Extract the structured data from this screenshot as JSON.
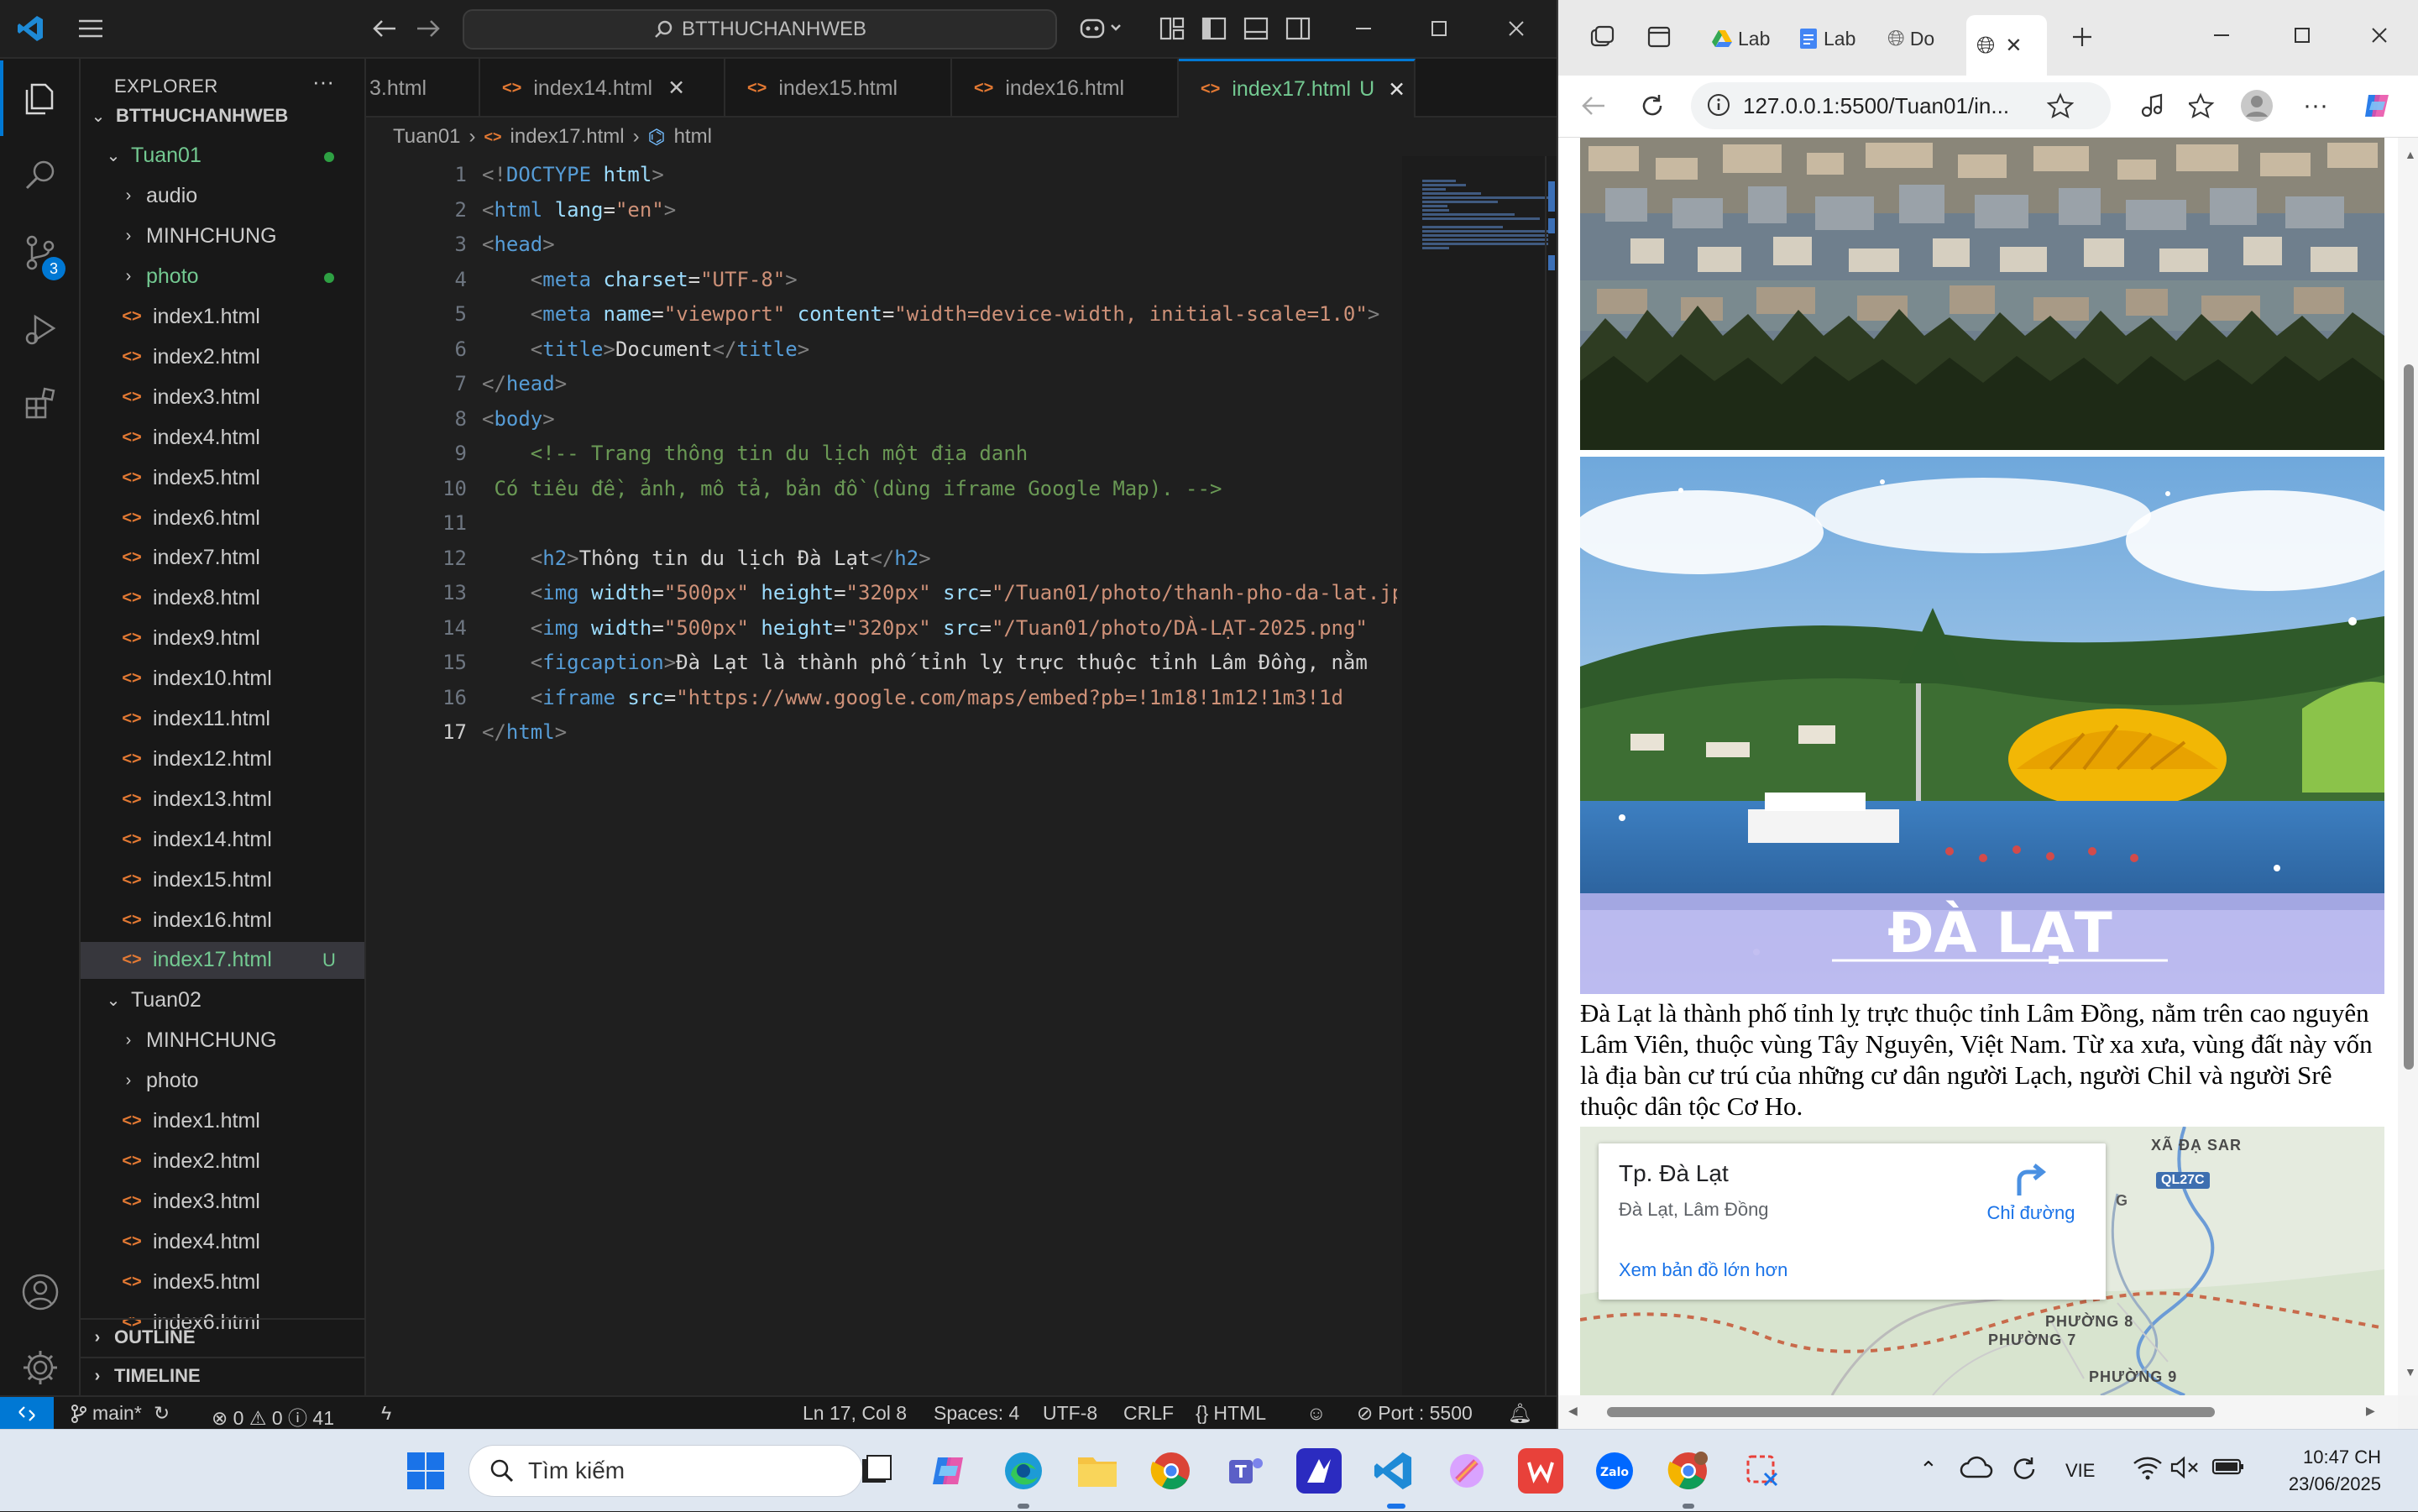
{
  "vscode": {
    "search_text": "BTTHUCHANHWEB",
    "activity_badge": "3",
    "explorer_title": "EXPLORER",
    "explorer_more": "···",
    "tree": [
      {
        "label": "BTTHUCHANHWEB",
        "kind": "root"
      },
      {
        "label": "Tuan01",
        "kind": "folder-open",
        "dot": true
      },
      {
        "label": "audio",
        "kind": "folder"
      },
      {
        "label": "MINHCHUNG",
        "kind": "folder"
      },
      {
        "label": "photo",
        "kind": "folder",
        "dot": true
      },
      {
        "label": "index1.html",
        "kind": "file"
      },
      {
        "label": "index2.html",
        "kind": "file"
      },
      {
        "label": "index3.html",
        "kind": "file"
      },
      {
        "label": "index4.html",
        "kind": "file"
      },
      {
        "label": "index5.html",
        "kind": "file"
      },
      {
        "label": "index6.html",
        "kind": "file"
      },
      {
        "label": "index7.html",
        "kind": "file"
      },
      {
        "label": "index8.html",
        "kind": "file"
      },
      {
        "label": "index9.html",
        "kind": "file"
      },
      {
        "label": "index10.html",
        "kind": "file"
      },
      {
        "label": "index11.html",
        "kind": "file"
      },
      {
        "label": "index12.html",
        "kind": "file"
      },
      {
        "label": "index13.html",
        "kind": "file"
      },
      {
        "label": "index14.html",
        "kind": "file"
      },
      {
        "label": "index15.html",
        "kind": "file"
      },
      {
        "label": "index16.html",
        "kind": "file"
      },
      {
        "label": "index17.html",
        "kind": "file",
        "selected": true,
        "badge": "U"
      },
      {
        "label": "Tuan02",
        "kind": "folder-open"
      },
      {
        "label": "MINHCHUNG",
        "kind": "folder"
      },
      {
        "label": "photo",
        "kind": "folder"
      },
      {
        "label": "index1.html",
        "kind": "file"
      },
      {
        "label": "index2.html",
        "kind": "file"
      },
      {
        "label": "index3.html",
        "kind": "file"
      },
      {
        "label": "index4.html",
        "kind": "file"
      },
      {
        "label": "index5.html",
        "kind": "file"
      },
      {
        "label": "index6.html",
        "kind": "file"
      }
    ],
    "outline": "OUTLINE",
    "timeline": "TIMELINE",
    "tabs": [
      {
        "label": "3.html"
      },
      {
        "label": "index14.html",
        "close": "✕"
      },
      {
        "label": "index15.html"
      },
      {
        "label": "index16.html"
      },
      {
        "label": "index17.html",
        "modified": "U",
        "active": true,
        "close": "✕"
      }
    ],
    "breadcrumb": [
      "Tuan01",
      "index17.html",
      "html"
    ],
    "code_lines": [
      "1",
      "2",
      "3",
      "4",
      "5",
      "6",
      "7",
      "8",
      "9",
      "10",
      "11",
      "12",
      "13",
      "14",
      "15",
      "16",
      "17"
    ],
    "code": {
      "l1": [
        {
          "c": "t-br",
          "t": "<!"
        },
        {
          "c": "t-tag",
          "t": "DOCTYPE"
        },
        {
          "c": "t-attr",
          "t": " html"
        },
        {
          "c": "t-br",
          "t": ">"
        }
      ],
      "l2": [
        {
          "c": "t-br",
          "t": "<"
        },
        {
          "c": "t-tag",
          "t": "html"
        },
        {
          "c": "t-attr",
          "t": " lang"
        },
        {
          "c": "t-txt",
          "t": "="
        },
        {
          "c": "t-str",
          "t": "\"en\""
        },
        {
          "c": "t-br",
          "t": ">"
        }
      ],
      "l3": [
        {
          "c": "t-br",
          "t": "<"
        },
        {
          "c": "t-tag",
          "t": "head"
        },
        {
          "c": "t-br",
          "t": ">"
        }
      ],
      "l4": [
        {
          "c": "t-txt",
          "t": "    "
        },
        {
          "c": "t-br",
          "t": "<"
        },
        {
          "c": "t-tag",
          "t": "meta"
        },
        {
          "c": "t-attr",
          "t": " charset"
        },
        {
          "c": "t-txt",
          "t": "="
        },
        {
          "c": "t-str",
          "t": "\"UTF-8\""
        },
        {
          "c": "t-br",
          "t": ">"
        }
      ],
      "l5": [
        {
          "c": "t-txt",
          "t": "    "
        },
        {
          "c": "t-br",
          "t": "<"
        },
        {
          "c": "t-tag",
          "t": "meta"
        },
        {
          "c": "t-attr",
          "t": " name"
        },
        {
          "c": "t-txt",
          "t": "="
        },
        {
          "c": "t-str",
          "t": "\"viewport\""
        },
        {
          "c": "t-attr",
          "t": " content"
        },
        {
          "c": "t-txt",
          "t": "="
        },
        {
          "c": "t-str",
          "t": "\"width=device-width, initial-scale=1.0\""
        },
        {
          "c": "t-br",
          "t": ">"
        }
      ],
      "l6": [
        {
          "c": "t-txt",
          "t": "    "
        },
        {
          "c": "t-br",
          "t": "<"
        },
        {
          "c": "t-tag",
          "t": "title"
        },
        {
          "c": "t-br",
          "t": ">"
        },
        {
          "c": "t-txt",
          "t": "Document"
        },
        {
          "c": "t-br",
          "t": "</"
        },
        {
          "c": "t-tag",
          "t": "title"
        },
        {
          "c": "t-br",
          "t": ">"
        }
      ],
      "l7": [
        {
          "c": "t-br",
          "t": "</"
        },
        {
          "c": "t-tag",
          "t": "head"
        },
        {
          "c": "t-br",
          "t": ">"
        }
      ],
      "l8": [
        {
          "c": "t-br",
          "t": "<"
        },
        {
          "c": "t-tag",
          "t": "body"
        },
        {
          "c": "t-br",
          "t": ">"
        }
      ],
      "l9": [
        {
          "c": "t-com",
          "t": "    <!-- Trang thông tin du lịch một địa danh"
        }
      ],
      "l10": [
        {
          "c": "t-com",
          "t": " Có tiêu đề, ảnh, mô tả, bản đồ (dùng iframe Google Map). -->"
        }
      ],
      "l11": [
        {
          "c": "t-txt",
          "t": ""
        }
      ],
      "l12": [
        {
          "c": "t-txt",
          "t": "    "
        },
        {
          "c": "t-br",
          "t": "<"
        },
        {
          "c": "t-tag",
          "t": "h2"
        },
        {
          "c": "t-br",
          "t": ">"
        },
        {
          "c": "t-txt",
          "t": "Thông tin du lịch Đà Lạt"
        },
        {
          "c": "t-br",
          "t": "</"
        },
        {
          "c": "t-tag",
          "t": "h2"
        },
        {
          "c": "t-br",
          "t": ">"
        }
      ],
      "l13": [
        {
          "c": "t-txt",
          "t": "    "
        },
        {
          "c": "t-br",
          "t": "<"
        },
        {
          "c": "t-tag",
          "t": "img"
        },
        {
          "c": "t-attr",
          "t": " width"
        },
        {
          "c": "t-txt",
          "t": "="
        },
        {
          "c": "t-str",
          "t": "\"500px\""
        },
        {
          "c": "t-attr",
          "t": " height"
        },
        {
          "c": "t-txt",
          "t": "="
        },
        {
          "c": "t-str",
          "t": "\"320px\""
        },
        {
          "c": "t-attr",
          "t": " src"
        },
        {
          "c": "t-txt",
          "t": "="
        },
        {
          "c": "t-str",
          "t": "\"/Tuan01/photo/thanh-pho-da-lat.jpg\""
        }
      ],
      "l14": [
        {
          "c": "t-txt",
          "t": "    "
        },
        {
          "c": "t-br",
          "t": "<"
        },
        {
          "c": "t-tag",
          "t": "img"
        },
        {
          "c": "t-attr",
          "t": " width"
        },
        {
          "c": "t-txt",
          "t": "="
        },
        {
          "c": "t-str",
          "t": "\"500px\""
        },
        {
          "c": "t-attr",
          "t": " height"
        },
        {
          "c": "t-txt",
          "t": "="
        },
        {
          "c": "t-str",
          "t": "\"320px\""
        },
        {
          "c": "t-attr",
          "t": " src"
        },
        {
          "c": "t-txt",
          "t": "="
        },
        {
          "c": "t-str",
          "t": "\"/Tuan01/photo/DÀ-LẠT-2025.png\""
        }
      ],
      "l15": [
        {
          "c": "t-txt",
          "t": "    "
        },
        {
          "c": "t-br",
          "t": "<"
        },
        {
          "c": "t-tag",
          "t": "figcaption"
        },
        {
          "c": "t-br",
          "t": ">"
        },
        {
          "c": "t-txt",
          "t": "Đà Lạt là thành phố tỉnh lỵ trực thuộc tỉnh Lâm Đồng, nằm"
        }
      ],
      "l16": [
        {
          "c": "t-txt",
          "t": "    "
        },
        {
          "c": "t-br",
          "t": "<"
        },
        {
          "c": "t-tag",
          "t": "iframe"
        },
        {
          "c": "t-attr",
          "t": " src"
        },
        {
          "c": "t-txt",
          "t": "="
        },
        {
          "c": "t-str",
          "t": "\"https://www.google.com/maps/embed?pb=!1m18!1m12!1m3!1d"
        }
      ],
      "l17": [
        {
          "c": "t-br",
          "t": "</"
        },
        {
          "c": "t-tag",
          "t": "html"
        },
        {
          "c": "t-br",
          "t": ">"
        }
      ]
    },
    "status": {
      "branch": "main*",
      "problems": "⊗ 0 ⚠ 0 ⓘ 41",
      "position": "Ln 17, Col 8",
      "spaces": "Spaces: 4",
      "encoding": "UTF-8",
      "eol": "CRLF",
      "language": "HTML",
      "port": "Port : 5500"
    }
  },
  "browser": {
    "tabs": [
      {
        "label": "Lab"
      },
      {
        "label": "Lab"
      },
      {
        "label": "Do"
      }
    ],
    "url": "127.0.0.1:5500/Tuan01/in...",
    "image2_text": "ĐÀ LẠT",
    "caption": "Đà Lạt là thành phố tỉnh lỵ trực thuộc tỉnh Lâm Đồng, nằm trên cao nguyên Lâm Viên, thuộc vùng Tây Nguyên, Việt Nam. Từ xa xưa, vùng đất này vốn là địa bàn cư trú của những cư dân người Lạch, người Chil và người Srê thuộc dân tộc Cơ Ho.",
    "map": {
      "place": "Tp. Đà Lạt",
      "region": "Đà Lạt, Lâm Đồng",
      "directions": "Chỉ đường",
      "larger_map": "Xem bản đồ lớn hơn",
      "labels": [
        "XÃ ĐẠ SAR",
        "QL27C",
        "G",
        "PHƯỜNG 8",
        "PHƯỜNG 7",
        "PHƯỜNG 9"
      ]
    }
  },
  "taskbar": {
    "search_placeholder": "Tìm kiếm",
    "lang": "VIE",
    "time": "10:47 CH",
    "date": "23/06/2025"
  }
}
